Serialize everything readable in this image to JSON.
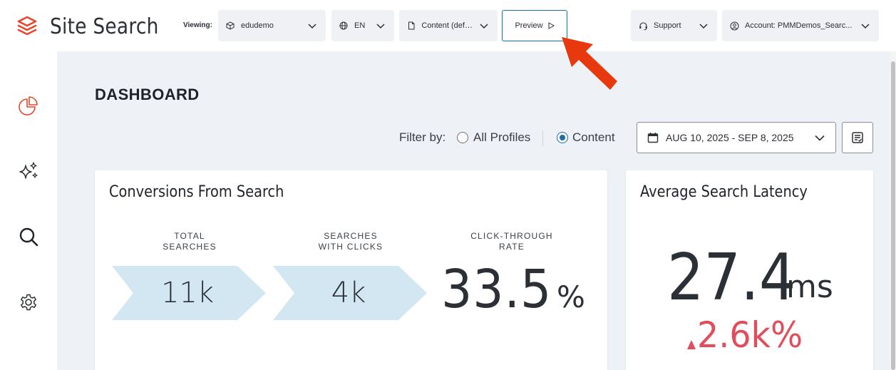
{
  "header": {
    "app_title": "Site Search",
    "viewing_label": "Viewing:",
    "site_select": "edudemo",
    "language_select": "EN",
    "content_select": "Content (defa...",
    "preview_label": "Preview",
    "support_label": "Support",
    "account_label": "Account: PMMDemos_Searc..."
  },
  "sidebar": {
    "items": [
      {
        "icon": "pie-chart-icon",
        "active": true
      },
      {
        "icon": "sparkles-icon",
        "active": false
      },
      {
        "icon": "search-icon",
        "active": false
      },
      {
        "icon": "gear-icon",
        "active": false
      }
    ]
  },
  "dashboard": {
    "title": "DASHBOARD",
    "filter_label": "Filter by:",
    "filter_options": [
      "All Profiles",
      "Content"
    ],
    "filter_selected": "Content",
    "date_range": "AUG 10, 2025 - SEP 8, 2025"
  },
  "conversions": {
    "title": "Conversions From Search",
    "total_searches_label_1": "TOTAL",
    "total_searches_label_2": "SEARCHES",
    "total_searches_value": "11k",
    "with_clicks_label_1": "SEARCHES",
    "with_clicks_label_2": "WITH CLICKS",
    "with_clicks_value": "4k",
    "ctr_label_1": "CLICK-THROUGH",
    "ctr_label_2": "RATE",
    "ctr_value": "33.5",
    "ctr_unit": "%"
  },
  "latency": {
    "title": "Average Search Latency",
    "value": "27.4",
    "unit": "ms",
    "change": "2.6k%",
    "change_direction": "up"
  },
  "colors": {
    "accent": "#1b6ea8",
    "brand": "#e8462a",
    "chevron_fill": "#d3e7f2",
    "negative": "#e24d5b",
    "arrow": "#e8390e"
  }
}
